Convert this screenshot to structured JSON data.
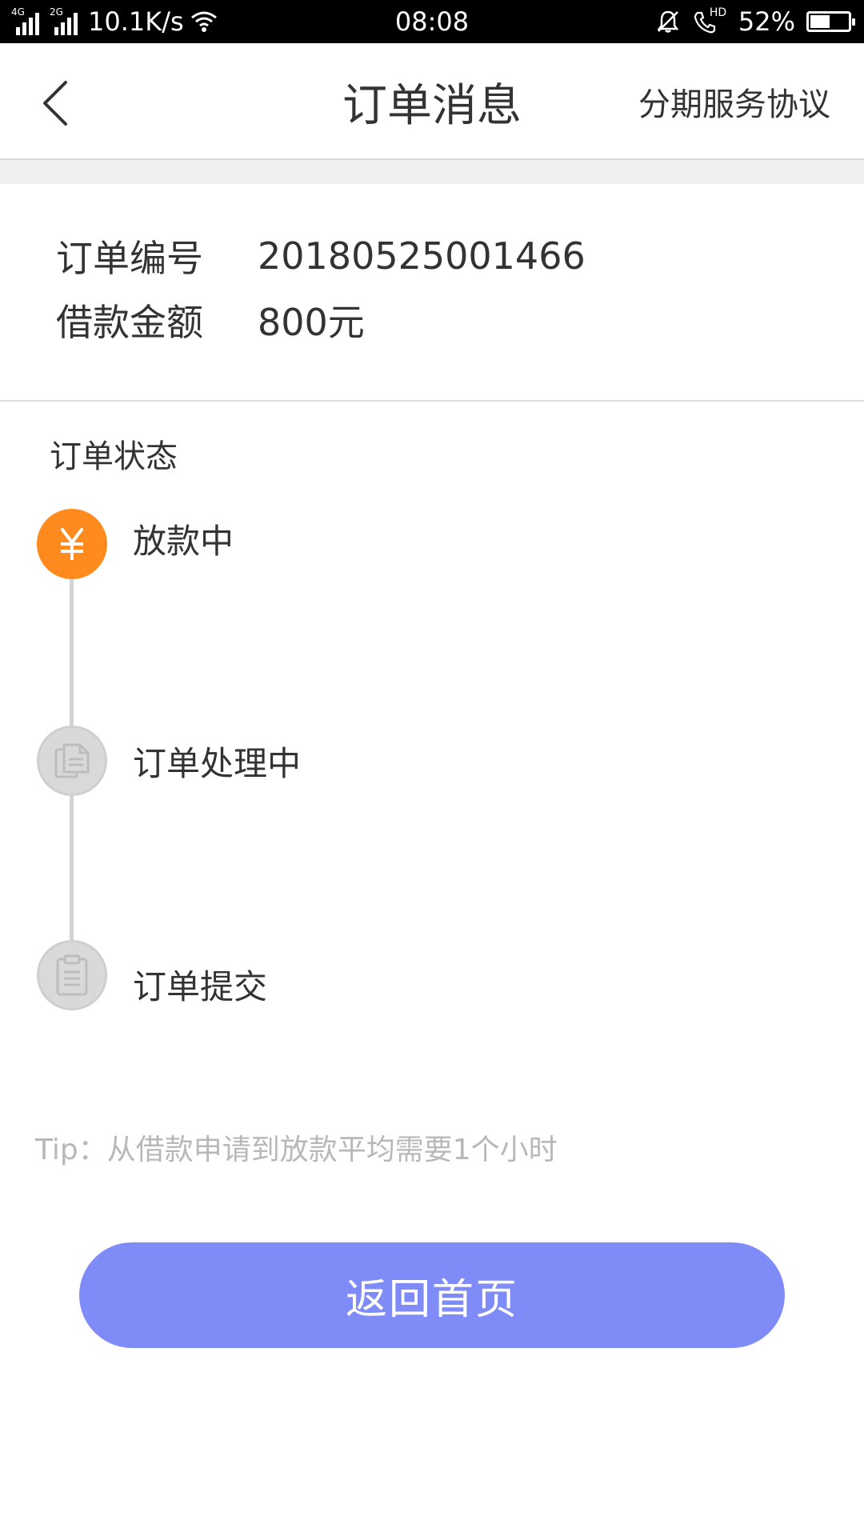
{
  "status_bar": {
    "net1": "4G",
    "net2": "2G",
    "speed": "10.1K/s",
    "time": "08:08",
    "hd": "HD",
    "battery": "52%",
    "battery_level": 0.52
  },
  "header": {
    "title": "订单消息",
    "agreement_link": "分期服务协议"
  },
  "order": {
    "number_label": "订单编号",
    "number_value": "20180525001466",
    "amount_label": "借款金额",
    "amount_value": "800元"
  },
  "status_section": {
    "title": "订单状态",
    "steps": [
      {
        "label": "放款中",
        "icon": "yuan-icon",
        "active": true
      },
      {
        "label": "订单处理中",
        "icon": "document-copy-icon",
        "active": false
      },
      {
        "label": "订单提交",
        "icon": "clipboard-icon",
        "active": false
      }
    ]
  },
  "tip": "Tip：从借款申请到放款平均需要1个小时",
  "home_button": "返回首页",
  "colors": {
    "accent_orange": "#ff8a1e",
    "button_blue": "#7f8cf7",
    "inactive_gray": "#d9d9d9"
  }
}
